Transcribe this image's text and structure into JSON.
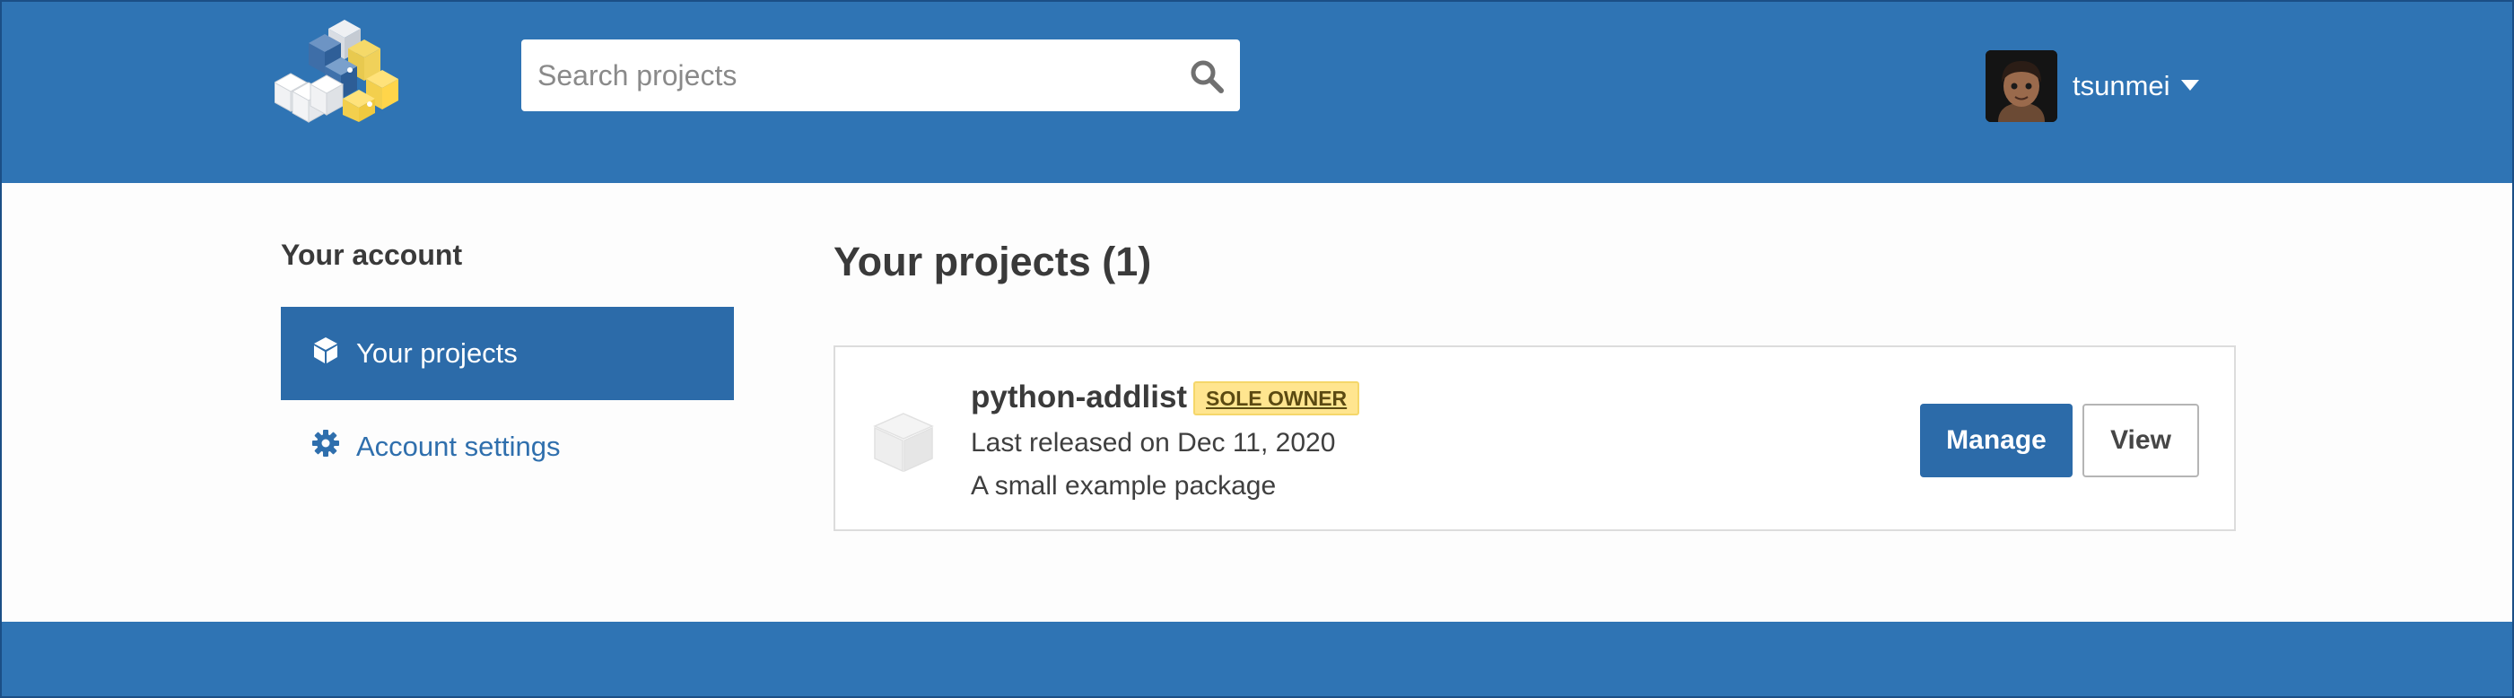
{
  "colors": {
    "brand_blue": "#2f74b4",
    "active_blue": "#2c6ba9",
    "link_blue": "#2f6fad",
    "badge_yellow": "#ffe58f",
    "text_dark": "#3a3a3a"
  },
  "header": {
    "logo_icon": "pypi-cubes-logo",
    "search": {
      "placeholder": "Search projects",
      "value": "",
      "icon": "search-icon"
    },
    "user": {
      "username": "tsunmei",
      "avatar": "user-avatar",
      "menu_icon": "caret-down-icon"
    }
  },
  "sidebar": {
    "heading": "Your account",
    "items": [
      {
        "label": "Your projects",
        "icon": "cube-icon",
        "active": true
      },
      {
        "label": "Account settings",
        "icon": "gear-icon",
        "active": false
      }
    ]
  },
  "main": {
    "title": "Your projects (1)",
    "projects": [
      {
        "name": "python-addlist",
        "badge": "SOLE OWNER",
        "released": "Last released on Dec 11, 2020",
        "description": "A small example package",
        "icon": "package-box-icon",
        "manage_label": "Manage",
        "view_label": "View"
      }
    ]
  }
}
